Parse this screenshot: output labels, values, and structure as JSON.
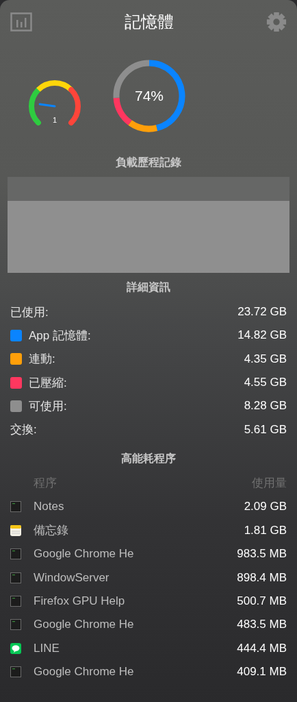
{
  "header": {
    "title": "記憶體"
  },
  "gauge": {
    "reading": "1"
  },
  "donut": {
    "reading": "74%",
    "segments": [
      {
        "color": "#0a84ff"
      },
      {
        "color": "#ff9f0a"
      },
      {
        "color": "#ff375f"
      },
      {
        "color": "#8e8e8e"
      }
    ]
  },
  "history": {
    "title": "負載歷程記錄"
  },
  "details": {
    "title": "詳細資訊",
    "rows": [
      {
        "kind": "plain",
        "label": "已使用:",
        "value": "23.72 GB"
      },
      {
        "kind": "swatch",
        "color": "#0a84ff",
        "label": "App 記憶體:",
        "value": "14.82 GB"
      },
      {
        "kind": "swatch",
        "color": "#ff9f0a",
        "label": "連動:",
        "value": "4.35 GB"
      },
      {
        "kind": "swatch",
        "color": "#ff375f",
        "label": "已壓縮:",
        "value": "4.55 GB"
      },
      {
        "kind": "swatch",
        "color": "#8e8e8e",
        "label": "可使用:",
        "value": "8.28 GB"
      },
      {
        "kind": "plain",
        "label": "交換:",
        "value": "5.61 GB"
      }
    ]
  },
  "top_processes": {
    "title": "高能耗程序",
    "columns": [
      "程序",
      "使用量"
    ],
    "rows": [
      {
        "kind": "terminal",
        "name": "Notes",
        "usage": "2.09 GB"
      },
      {
        "kind": "notes",
        "name": "備忘錄",
        "usage": "1.81 GB"
      },
      {
        "kind": "terminal",
        "name": "Google Chrome He",
        "usage": "983.5 MB"
      },
      {
        "kind": "terminal",
        "name": "WindowServer",
        "usage": "898.4 MB"
      },
      {
        "kind": "terminal",
        "name": "Firefox GPU Help",
        "usage": "500.7 MB"
      },
      {
        "kind": "terminal",
        "name": "Google Chrome He",
        "usage": "483.5 MB"
      },
      {
        "kind": "chat",
        "name": "LINE",
        "usage": "444.4 MB"
      },
      {
        "kind": "terminal",
        "name": "Google Chrome He",
        "usage": "409.1 MB"
      }
    ]
  }
}
